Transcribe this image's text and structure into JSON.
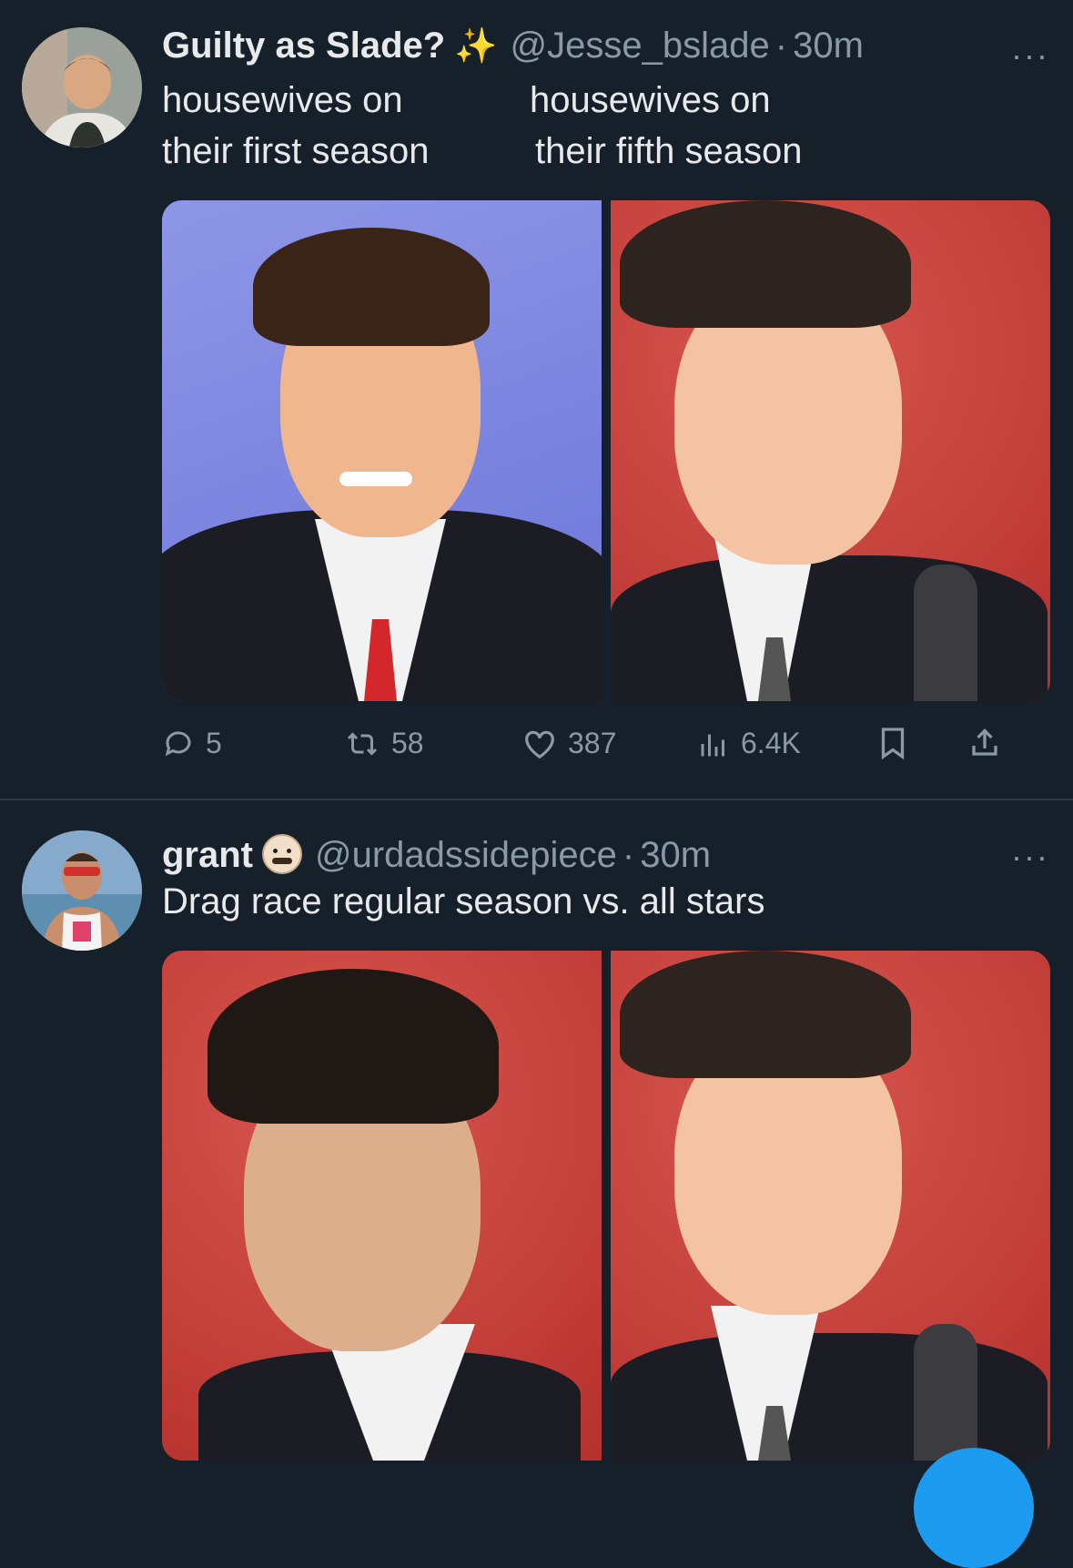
{
  "tweets": [
    {
      "display_name": "Guilty as Slade?",
      "name_emoji": "✨",
      "handle": "@Jesse_bslade",
      "separator": "·",
      "time": "30m",
      "more": "···",
      "text_left": [
        "housewives on",
        "their first season"
      ],
      "text_right": [
        "housewives on",
        "their fifth season"
      ],
      "actions": {
        "replies": "5",
        "reposts": "58",
        "likes": "387",
        "views": "6.4K"
      }
    },
    {
      "display_name": "grant",
      "handle": "@urdadssidepiece",
      "separator": "·",
      "time": "30m",
      "more": "···",
      "text": "Drag race regular season vs. all stars"
    }
  ],
  "colors": {
    "background": "#15202b",
    "text_primary": "#e7e9ea",
    "text_secondary": "#8b98a5",
    "accent": "#1d9bf0"
  }
}
